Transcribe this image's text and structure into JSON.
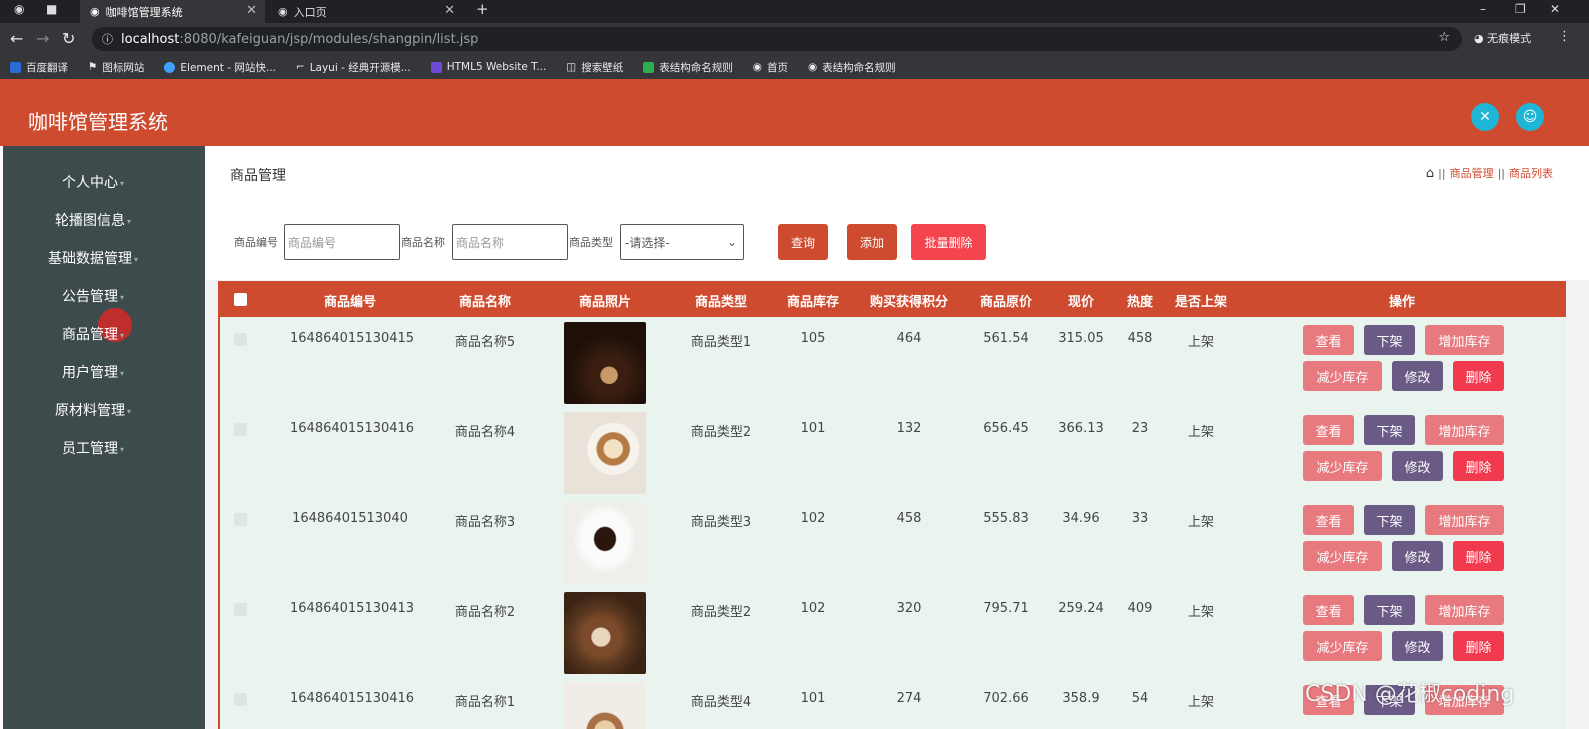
{
  "browser": {
    "tabs": [
      {
        "title": "咖啡馆管理系统",
        "active": true
      },
      {
        "title": "入口页",
        "active": false
      }
    ],
    "url_host": "localhost",
    "url_path": ":8080/kafeiguan/jsp/modules/shangpin/list.jsp",
    "profile_label": "无痕模式",
    "bookmarks": [
      "百度翻译",
      "图标网站",
      "Element - 网站快...",
      "Layui - 经典开源模...",
      "HTML5 Website T...",
      "搜索壁纸",
      "表结构命名规则",
      "首页",
      "表结构命名规则"
    ]
  },
  "header": {
    "title": "咖啡馆管理系统"
  },
  "sidebar": {
    "items": [
      {
        "label": "个人中心"
      },
      {
        "label": "轮播图信息"
      },
      {
        "label": "基础数据管理"
      },
      {
        "label": "公告管理"
      },
      {
        "label": "商品管理"
      },
      {
        "label": "用户管理"
      },
      {
        "label": "原材料管理"
      },
      {
        "label": "员工管理"
      }
    ]
  },
  "page": {
    "title": "商品管理",
    "breadcrumb": [
      "商品管理",
      "商品列表"
    ]
  },
  "filter": {
    "code_label": "商品编号",
    "code_placeholder": "商品编号",
    "name_label": "商品名称",
    "name_placeholder": "商品名称",
    "type_label": "商品类型",
    "type_selected": "-请选择-",
    "query_button": "查询",
    "add_button": "添加",
    "batch_delete_button": "批量删除"
  },
  "table": {
    "columns": [
      "商品编号",
      "商品名称",
      "商品照片",
      "商品类型",
      "商品库存",
      "购买获得积分",
      "商品原价",
      "现价",
      "热度",
      "是否上架",
      "操作"
    ],
    "actions": {
      "view": "查看",
      "offshelf": "下架",
      "add_stock": "增加库存",
      "reduce_stock": "减少库存",
      "edit": "修改",
      "delete": "删除"
    },
    "rows": [
      {
        "code": "164864015130415",
        "name": "商品名称5",
        "type": "商品类型1",
        "stock": "105",
        "points": "464",
        "orig_price": "561.54",
        "price": "315.05",
        "heat": "458",
        "status": "上架"
      },
      {
        "code": "164864015130416",
        "name": "商品名称4",
        "type": "商品类型2",
        "stock": "101",
        "points": "132",
        "orig_price": "656.45",
        "price": "366.13",
        "heat": "23",
        "status": "上架"
      },
      {
        "code": "16486401513040",
        "name": "商品名称3",
        "type": "商品类型3",
        "stock": "102",
        "points": "458",
        "orig_price": "555.83",
        "price": "34.96",
        "heat": "33",
        "status": "上架"
      },
      {
        "code": "164864015130413",
        "name": "商品名称2",
        "type": "商品类型2",
        "stock": "102",
        "points": "320",
        "orig_price": "795.71",
        "price": "259.24",
        "heat": "409",
        "status": "上架"
      },
      {
        "code": "164864015130416",
        "name": "商品名称1",
        "type": "商品类型4",
        "stock": "101",
        "points": "274",
        "orig_price": "702.66",
        "price": "358.9",
        "heat": "54",
        "status": "上架"
      }
    ]
  },
  "watermark": "CSDN @花椒coding",
  "colors": {
    "brand": "#cf4b2f",
    "sidebar": "#3e4b4d",
    "accent_cyan": "#1fb5d6",
    "view_btn": "#e87a7f",
    "offshelf_btn": "#6a5a86",
    "delete_btn": "#f23a4e"
  }
}
